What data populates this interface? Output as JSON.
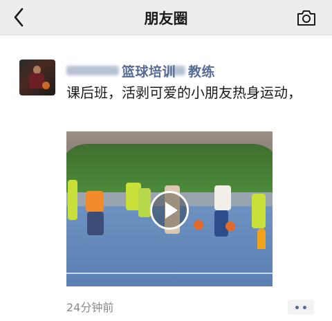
{
  "header": {
    "title": "朋友圈",
    "back_icon": "chevron-left-icon",
    "camera_icon": "camera-icon"
  },
  "post": {
    "author_name": "篮球培训",
    "author_name_suffix": "教练",
    "caption": "课后班，活剥可爱的小朋友热身运动，",
    "video": {
      "play_icon": "play-icon"
    },
    "time": "24分钟前",
    "more_icon": "more-dots-icon"
  },
  "colors": {
    "name_link": "#576b95",
    "header_bg": "#ededed",
    "time_text": "#8a8a8a"
  }
}
